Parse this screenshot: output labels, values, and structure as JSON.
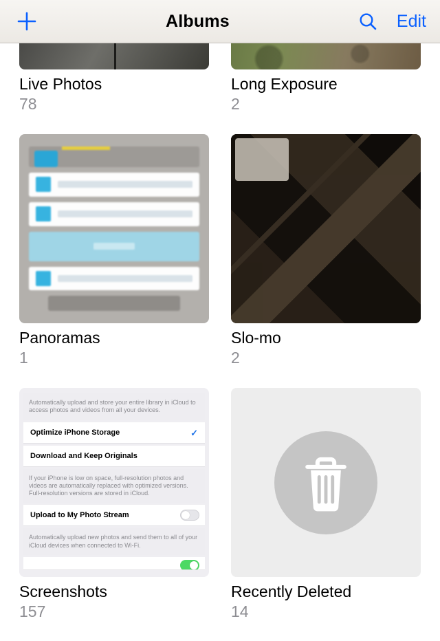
{
  "navbar": {
    "title": "Albums",
    "edit": "Edit"
  },
  "albums": [
    {
      "title": "Live Photos",
      "count": "78"
    },
    {
      "title": "Long Exposure",
      "count": "2"
    },
    {
      "title": "Panoramas",
      "count": "1"
    },
    {
      "title": "Slo-mo",
      "count": "2"
    },
    {
      "title": "Screenshots",
      "count": "157"
    },
    {
      "title": "Recently Deleted",
      "count": "14"
    }
  ],
  "screenshots_thumb": {
    "desc1": "Automatically upload and store your entire library in iCloud to access photos and videos from all your devices.",
    "opt1": "Optimize iPhone Storage",
    "opt2": "Download and Keep Originals",
    "desc2": "If your iPhone is low on space, full-resolution photos and videos are automatically replaced with optimized versions. Full-resolution versions are stored in iCloud.",
    "opt3": "Upload to My Photo Stream",
    "desc3": "Automatically upload new photos and send them to all of your iCloud devices when connected to Wi-Fi."
  }
}
